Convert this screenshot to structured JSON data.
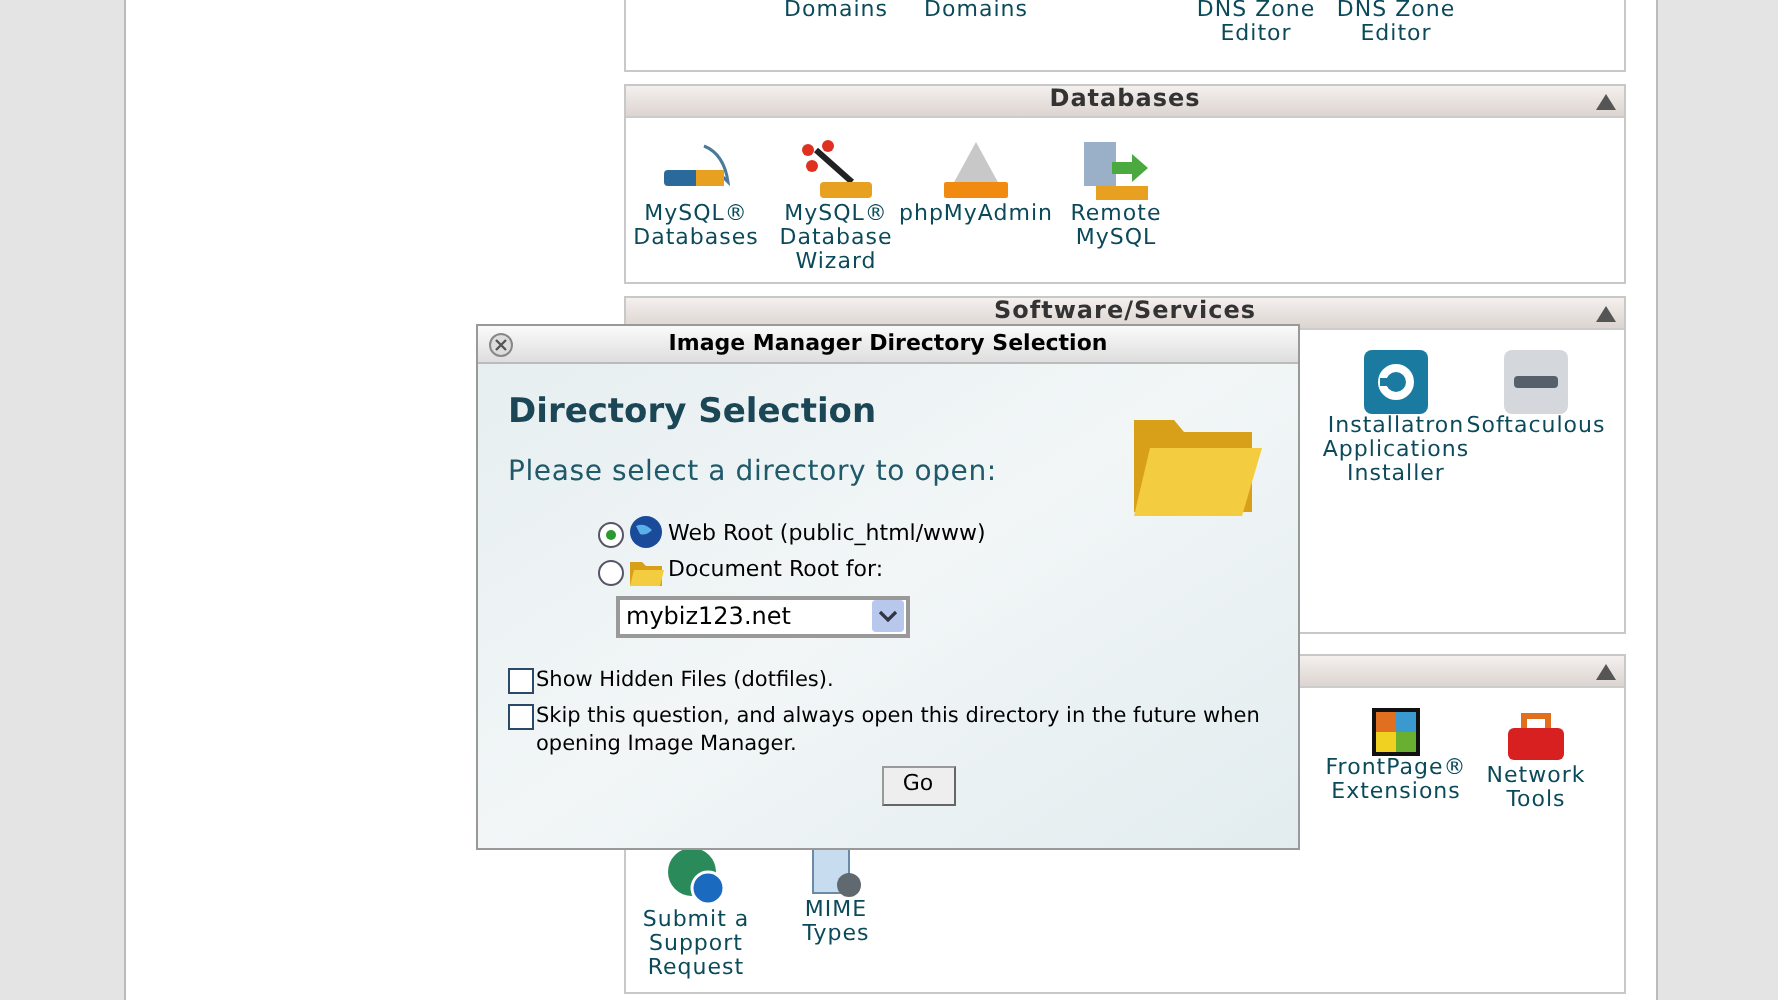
{
  "top_panel": {
    "items": [
      {
        "lines": [
          "Domains"
        ]
      },
      {
        "lines": [
          "Domains"
        ]
      },
      {
        "lines": [
          "DNS Zone",
          "Editor"
        ]
      },
      {
        "lines": [
          "DNS Zone",
          "Editor"
        ]
      }
    ]
  },
  "databases": {
    "title": "Databases",
    "items": [
      {
        "kind": "mysql",
        "lines": [
          "MySQL®",
          "Databases"
        ]
      },
      {
        "kind": "wizard",
        "lines": [
          "MySQL®",
          "Database",
          "Wizard"
        ]
      },
      {
        "kind": "phpmyadmin",
        "lines": [
          "phpMyAdmin"
        ]
      },
      {
        "kind": "remote",
        "lines": [
          "Remote",
          "MySQL"
        ]
      }
    ]
  },
  "software": {
    "title": "Software/Services",
    "items": [
      {
        "kind": "installatron",
        "lines": [
          "Installatron",
          "Applications",
          "Installer"
        ]
      },
      {
        "kind": "softaculous",
        "lines": [
          "Softaculous"
        ]
      }
    ]
  },
  "advanced": {
    "items": [
      {
        "kind": "frontpage",
        "lines": [
          "FrontPage®",
          "Extensions"
        ]
      },
      {
        "kind": "toolbox",
        "lines": [
          "Network",
          "Tools"
        ]
      },
      {
        "kind": "support",
        "lines": [
          "Submit a",
          "Support",
          "Request"
        ]
      },
      {
        "kind": "mime",
        "lines": [
          "MIME",
          "Types"
        ]
      }
    ]
  },
  "dialog": {
    "title": "Image Manager Directory Selection",
    "heading": "Directory Selection",
    "prompt": "Please select a directory to open:",
    "options": [
      {
        "kind": "globe",
        "label": "Web Root (public_html/www)",
        "selected": true
      },
      {
        "kind": "folder",
        "label": "Document Root for:",
        "selected": false
      }
    ],
    "domain_select": {
      "value": "mybiz123.net"
    },
    "checkboxes": [
      {
        "label": "Show Hidden Files (dotfiles).",
        "checked": false
      },
      {
        "label": "Skip this question, and always open this directory in the future when opening Image Manager.",
        "checked": false
      }
    ],
    "button": "Go"
  }
}
